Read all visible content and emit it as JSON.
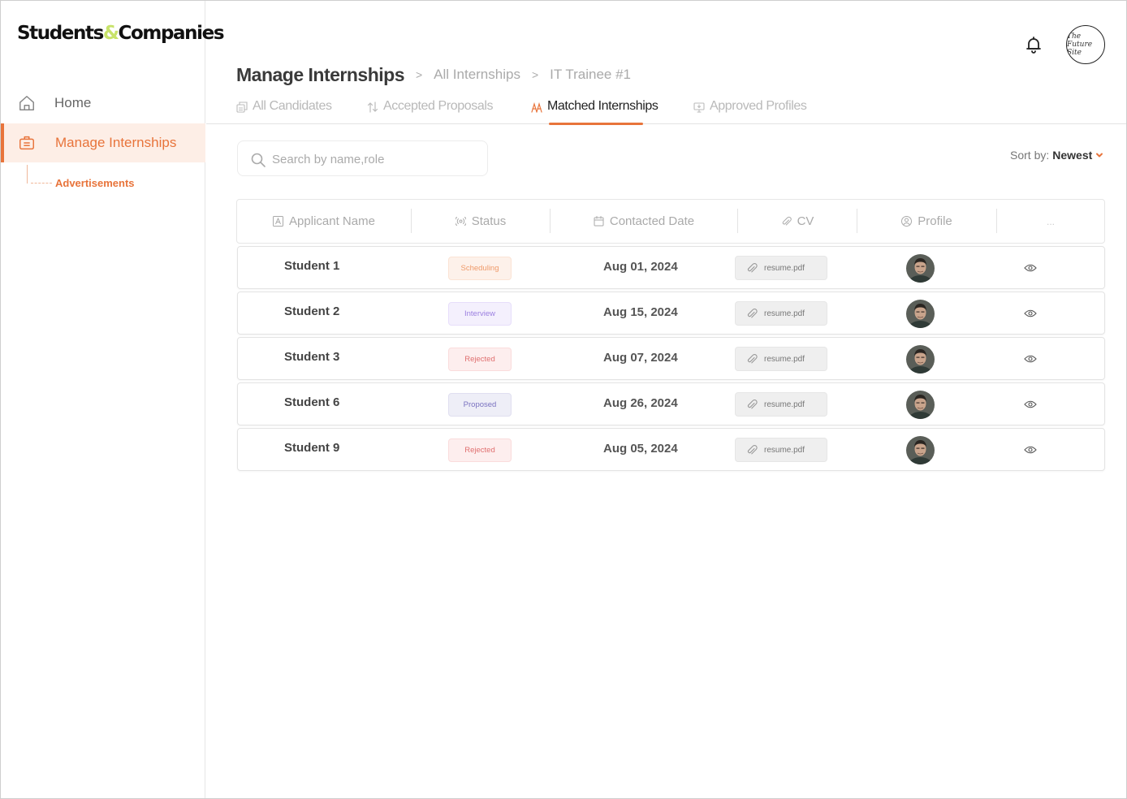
{
  "app": {
    "logo_part1": "Students",
    "logo_amp": "&",
    "logo_part2": "Companies",
    "logo_accent": "#c8e36a"
  },
  "sidebar": {
    "items": [
      {
        "label": "Home",
        "icon": "home-icon",
        "active": false
      },
      {
        "label": "Manage Internships",
        "icon": "briefcase-icon",
        "active": true
      }
    ],
    "subitems": [
      {
        "label": "Advertisements"
      }
    ]
  },
  "header": {
    "notification_icon": "bell-icon",
    "company_logo_text": "The Future Site"
  },
  "breadcrumb": {
    "title": "Manage Internships",
    "separator": ">",
    "items": [
      "All Internships",
      "IT Trainee #1"
    ]
  },
  "tabs": [
    {
      "label": "All Candidates",
      "icon": "candidates-icon",
      "active": false
    },
    {
      "label": "Accepted Proposals",
      "icon": "swap-icon",
      "active": false
    },
    {
      "label": "Matched Internships",
      "icon": "match-icon",
      "active": true
    },
    {
      "label": "Approved Profiles",
      "icon": "monitor-icon",
      "active": false
    }
  ],
  "search": {
    "placeholder": "Search by name,role",
    "value": ""
  },
  "sort": {
    "label": "Sort by:",
    "value": "Newest"
  },
  "table": {
    "columns": [
      {
        "label": "Applicant Name",
        "icon": "letter-a-icon"
      },
      {
        "label": "Status",
        "icon": "signal-icon"
      },
      {
        "label": "Contacted Date",
        "icon": "calendar-icon"
      },
      {
        "label": "CV",
        "icon": "paperclip-icon"
      },
      {
        "label": "Profile",
        "icon": "user-circle-icon"
      },
      {
        "label": "...",
        "icon": ""
      }
    ],
    "rows": [
      {
        "name": "Student 1",
        "status": "Scheduling",
        "date": "Aug 01, 2024",
        "cv": "resume.pdf"
      },
      {
        "name": "Student 2",
        "status": "Interview",
        "date": "Aug 15, 2024",
        "cv": "resume.pdf"
      },
      {
        "name": "Student 3",
        "status": "Rejected",
        "date": "Aug 07, 2024",
        "cv": "resume.pdf"
      },
      {
        "name": "Student 6",
        "status": "Proposed",
        "date": "Aug 26, 2024",
        "cv": "resume.pdf"
      },
      {
        "name": "Student 9",
        "status": "Rejected",
        "date": "Aug 05, 2024",
        "cv": "resume.pdf"
      }
    ]
  },
  "colors": {
    "accent": "#e8743b",
    "status": {
      "Scheduling": {
        "bg": "#fdf1ea",
        "fg": "#ef9a6a",
        "border": "#fbe3d4"
      },
      "Interview": {
        "bg": "#f4f0fd",
        "fg": "#9b7fe0",
        "border": "#e7defb"
      },
      "Rejected": {
        "bg": "#fdeeee",
        "fg": "#e07070",
        "border": "#fadcdc"
      },
      "Proposed": {
        "bg": "#eeeef7",
        "fg": "#7a72c0",
        "border": "#e0dff0"
      }
    }
  }
}
